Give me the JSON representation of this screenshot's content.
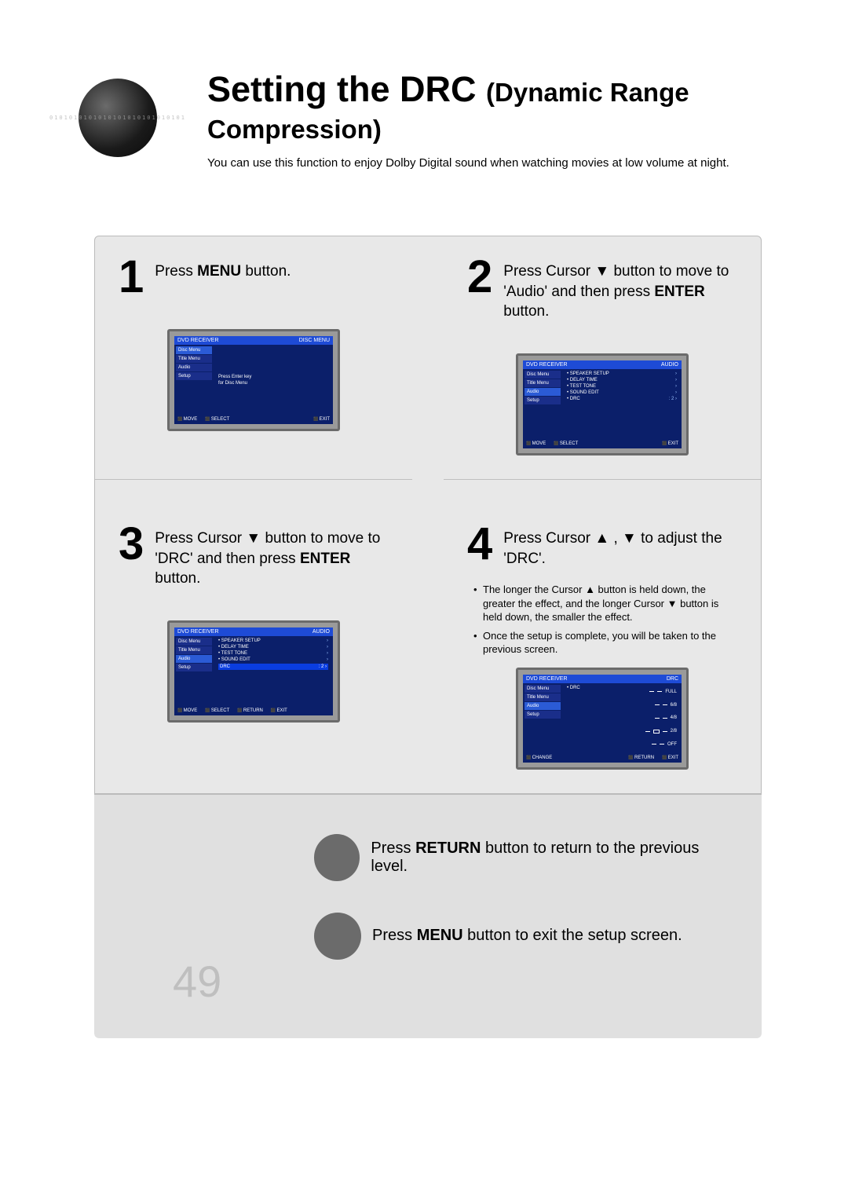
{
  "header": {
    "title_main": "Setting the DRC",
    "title_paren": "(Dynamic Range Compression)",
    "intro": "You can use this function to enjoy Dolby Digital sound when watching movies at low volume at night."
  },
  "steps": [
    {
      "num": "1",
      "text_pre": "Press ",
      "bold": "MENU",
      "text_post": " button."
    },
    {
      "num": "2",
      "text_pre": "Press Cursor ▼ button to move to 'Audio' and then press ",
      "bold": "ENTER",
      "text_post": " button."
    },
    {
      "num": "3",
      "text_pre": "Press Cursor ▼ button to move to 'DRC' and then press ",
      "bold": "ENTER",
      "text_post": " button."
    },
    {
      "num": "4",
      "text_pre": "Press Cursor ▲ , ▼  to adjust the 'DRC'.",
      "bold": "",
      "text_post": ""
    }
  ],
  "bullets": [
    "The longer the Cursor ▲ button is held down, the greater the effect, and the longer Cursor ▼ button is held down, the smaller the effect.",
    "Once the setup is complete, you will be taken to the previous screen."
  ],
  "osd1": {
    "crumb": "DVD RECEIVER",
    "title": "DISC MENU",
    "side": [
      "Disc Menu",
      "Title Menu",
      "Audio",
      "Setup"
    ],
    "main": [
      "Press Enter key",
      "for Disc Menu"
    ],
    "foot": [
      "MOVE",
      "SELECT",
      "EXIT"
    ]
  },
  "osd2": {
    "crumb": "DVD RECEIVER",
    "title": "AUDIO",
    "side": [
      "Disc Menu",
      "Title Menu",
      "Audio",
      "Setup"
    ],
    "main": [
      [
        "• SPEAKER SETUP",
        "›"
      ],
      [
        "• DELAY TIME",
        "›"
      ],
      [
        "• TEST TONE",
        "›"
      ],
      [
        "• SOUND EDIT",
        "›"
      ],
      [
        "• DRC",
        ": 2    ›"
      ]
    ],
    "foot": [
      "MOVE",
      "SELECT",
      "EXIT"
    ]
  },
  "osd3": {
    "crumb": "DVD RECEIVER",
    "title": "AUDIO",
    "side": [
      "Disc Menu",
      "Title Menu",
      "Audio",
      "Setup"
    ],
    "main": [
      [
        "• SPEAKER SETUP",
        "›"
      ],
      [
        "• DELAY TIME",
        "›"
      ],
      [
        "• TEST TONE",
        "›"
      ],
      [
        "• SOUND EDIT",
        "›"
      ],
      [
        "DRC",
        ": 2    ›"
      ]
    ],
    "foot": [
      "MOVE",
      "SELECT",
      "RETURN",
      "EXIT"
    ]
  },
  "osd4": {
    "crumb": "DVD RECEIVER",
    "title": "DRC",
    "side": [
      "Disc Menu",
      "Title Menu",
      "Audio",
      "Setup"
    ],
    "main": [
      [
        "• DRC",
        ""
      ]
    ],
    "meter": [
      "FULL",
      "6/8",
      "4/8",
      "2/8",
      "OFF"
    ],
    "foot": [
      "CHANGE",
      "RETURN",
      "EXIT"
    ]
  },
  "footer": {
    "return_pre": "Press ",
    "return_bold": "RETURN",
    "return_post": " button to return to the previous level.",
    "menu_pre": "Press ",
    "menu_bold": "MENU",
    "menu_post": " button to exit the setup screen.",
    "page": "49"
  }
}
